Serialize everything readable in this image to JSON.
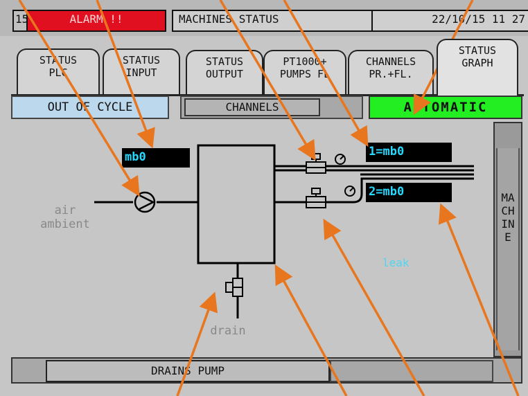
{
  "header": {
    "alarm_number": "15",
    "alarm_label": "ALARM !!",
    "machine_status": "MACHINES STATUS",
    "datetime": "22/10/15 11 27"
  },
  "tabs": [
    {
      "label": "STATUS\nPLC"
    },
    {
      "label": "STATUS\nINPUT"
    },
    {
      "label": "STATUS\nOUTPUT"
    },
    {
      "label": "PT1000+\nPUMPS FL"
    },
    {
      "label": "CHANNELS\nPR.+FL."
    },
    {
      "label": "STATUS\nGRAPH"
    }
  ],
  "status_row": {
    "cycle_state": "OUT OF CYCLE",
    "channels": "CHANNELS",
    "mode": "AUTOMATIC"
  },
  "diagram": {
    "pressure_main": "mb0",
    "pressure_ch1": "1=mb0",
    "pressure_ch2": "2=mb0",
    "air_label": "air\nambient",
    "drain_label": "drain",
    "leak_label": "leak"
  },
  "side_panel": {
    "label": "MACHINE"
  },
  "bottom": {
    "drains_pump": "DRAINS PUMP"
  },
  "colors": {
    "alarm_red": "#e01020",
    "automatic_green": "#22ee22",
    "cycle_blue": "#bcd8ec",
    "display_cyan": "#26d9ff",
    "annotation_arrow": "#e8761e"
  }
}
